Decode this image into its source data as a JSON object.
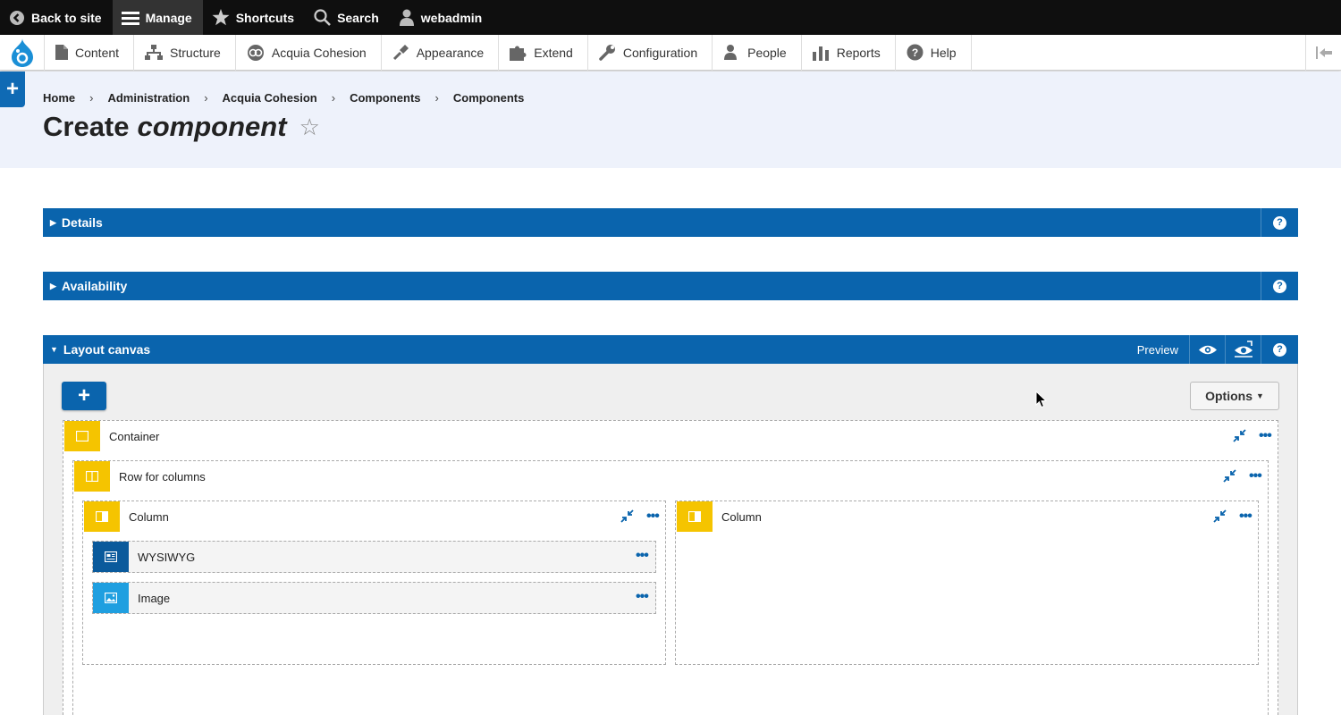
{
  "topbar": {
    "back": "Back to site",
    "manage": "Manage",
    "shortcuts": "Shortcuts",
    "search": "Search",
    "user": "webadmin"
  },
  "tray": {
    "items": [
      "Content",
      "Structure",
      "Acquia Cohesion",
      "Appearance",
      "Extend",
      "Configuration",
      "People",
      "Reports",
      "Help"
    ]
  },
  "breadcrumb": [
    "Home",
    "Administration",
    "Acquia Cohesion",
    "Components",
    "Components"
  ],
  "page": {
    "title_plain": "Create",
    "title_italic": "component",
    "star": "☆"
  },
  "accordions": {
    "details": "Details",
    "availability": "Availability",
    "layout_canvas": "Layout canvas",
    "preview": "Preview"
  },
  "canvas": {
    "add": "+",
    "options": "Options",
    "container": "Container",
    "row": "Row for columns",
    "column_left": "Column",
    "column_right": "Column",
    "wysiwyg": "WYSIWYG",
    "image": "Image",
    "more": "•••"
  },
  "colors": {
    "primary": "#0a64ad",
    "layout_yellow": "#f5c400",
    "topbar": "#0f0f0f"
  }
}
